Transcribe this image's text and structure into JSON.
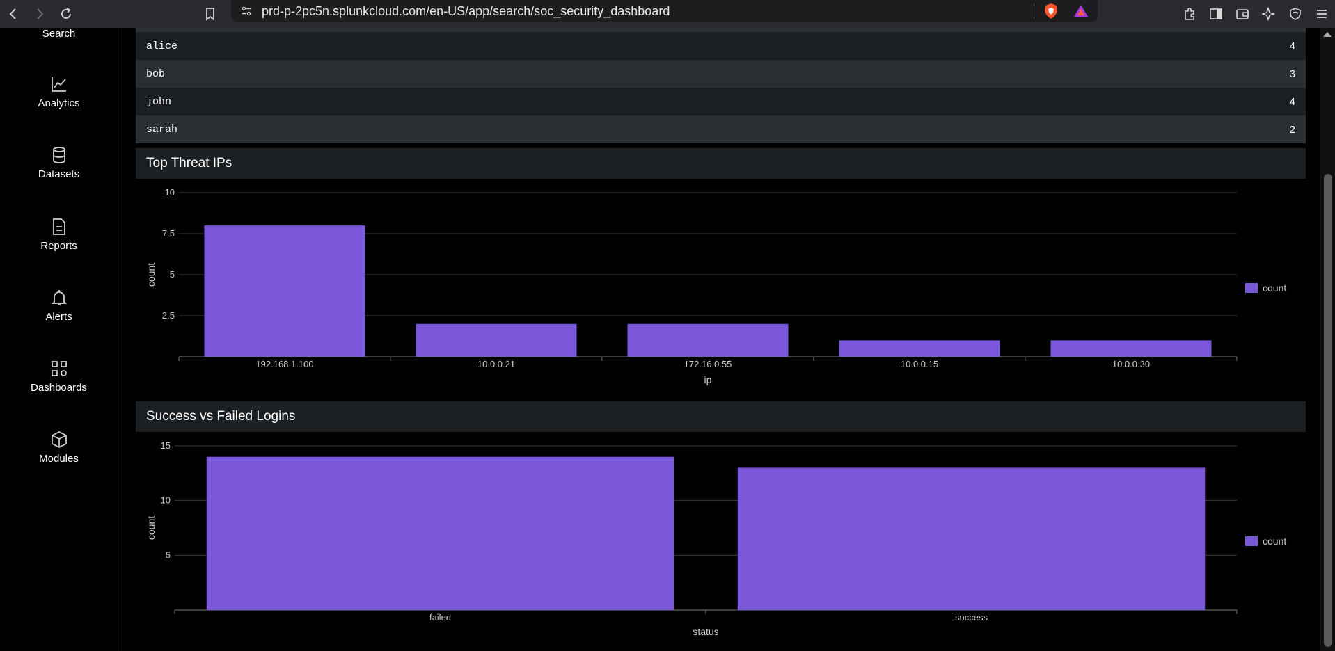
{
  "browser": {
    "url": "prd-p-2pc5n.splunkcloud.com/en-US/app/search/soc_security_dashboard"
  },
  "nav": {
    "items": [
      {
        "label": "Search",
        "icon": "search-icon"
      },
      {
        "label": "Analytics",
        "icon": "analytics-icon"
      },
      {
        "label": "Datasets",
        "icon": "datasets-icon"
      },
      {
        "label": "Reports",
        "icon": "reports-icon"
      },
      {
        "label": "Alerts",
        "icon": "alerts-icon"
      },
      {
        "label": "Dashboards",
        "icon": "dashboards-icon"
      },
      {
        "label": "Modules",
        "icon": "modules-icon"
      }
    ]
  },
  "user_table": {
    "rows": [
      {
        "user": "alice",
        "count": "4"
      },
      {
        "user": "bob",
        "count": "3"
      },
      {
        "user": "john",
        "count": "4"
      },
      {
        "user": "sarah",
        "count": "2"
      }
    ]
  },
  "panels": {
    "threat_ips": {
      "title": "Top Threat IPs"
    },
    "logins": {
      "title": "Success vs Failed Logins"
    }
  },
  "chart_data": [
    {
      "type": "bar",
      "title": "Top Threat IPs",
      "categories": [
        "192.168.1.100",
        "10.0.0.21",
        "172.16.0.55",
        "10.0.0.15",
        "10.0.0.30"
      ],
      "series": [
        {
          "name": "count",
          "values": [
            8,
            2,
            2,
            1,
            1
          ]
        }
      ],
      "xlabel": "ip",
      "ylabel": "count",
      "ylim": [
        0,
        10
      ],
      "yticks": [
        "2.5",
        "5",
        "7.5",
        "10"
      ],
      "grid": true,
      "legend": "right",
      "color": "#7b57d9"
    },
    {
      "type": "bar",
      "title": "Success vs Failed Logins",
      "categories": [
        "failed",
        "success"
      ],
      "series": [
        {
          "name": "count",
          "values": [
            14,
            13
          ]
        }
      ],
      "xlabel": "status",
      "ylabel": "count",
      "ylim": [
        0,
        15
      ],
      "yticks": [
        "5",
        "10",
        "15"
      ],
      "grid": true,
      "legend": "right",
      "color": "#7b57d9"
    }
  ]
}
